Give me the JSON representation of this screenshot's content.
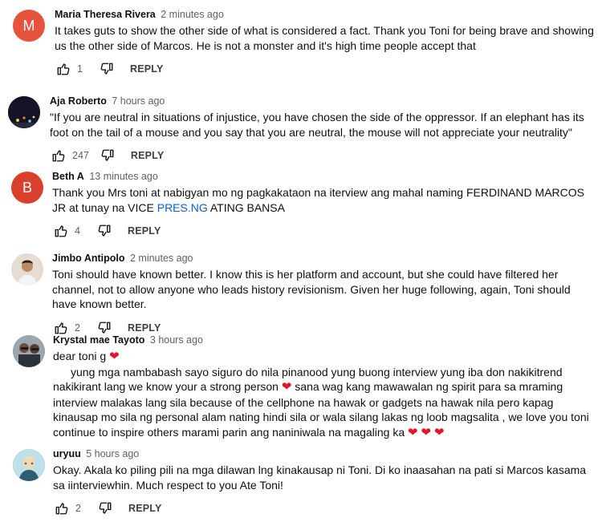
{
  "comments": [
    {
      "author": "Maria Theresa Rivera",
      "time": "2 minutes ago",
      "avatar_letter": "M",
      "avatar_color": "#e5533d",
      "text": "It takes guts to show the other side of what is considered a fact.  Thank you Toni for being brave and showing us the other side of Marcos.  He is not a monster and it's high time people accept that",
      "likes": "1",
      "reply_label": "REPLY"
    },
    {
      "author": "Aja Roberto",
      "time": "7 hours ago",
      "avatar_letter": "",
      "avatar_color": "#1b1b2e",
      "text": "\"If you are neutral in situations of injustice, you have chosen the side of the oppressor. If an elephant has its foot on the tail of a mouse and you say that you are neutral, the mouse will not appreciate your neutrality\"",
      "likes": "247",
      "reply_label": "REPLY"
    },
    {
      "author": "Beth A",
      "time": "13 minutes ago",
      "avatar_letter": "B",
      "avatar_color": "#d93f2b",
      "text_pre": "Thank you Mrs toni at nabigyan mo ng pagkakataon na iterview ang mahal naming FERDINAND MARCOS JR at tunay na VICE ",
      "text_link": "PRES.NG",
      "text_post": " ATING BANSA",
      "likes": "4",
      "reply_label": "REPLY"
    },
    {
      "author": "Jimbo Antipolo",
      "time": "2 minutes ago",
      "avatar_letter": "",
      "avatar_color": "#d8c7b8",
      "text": "Toni should have known better. I know this is her platform and account, but she could have filtered her channel, not to allow anyone who leads history revisionism. Given her huge following, again, Toni should have known better.",
      "likes": "2",
      "reply_label": "REPLY"
    },
    {
      "author": "Krystal mae Tayoto",
      "time": "3 hours ago",
      "avatar_letter": "",
      "avatar_color": "#8a9aa6",
      "line1": "dear toni g",
      "line2_indent": "yung mga nambabash sayo siguro do nila pinanood yung buong interview yung iba don nakikitrend nakikirant lang we know your a strong person",
      "line2_cont": " sana wag kang mawawalan ng spirit para sa mraming interview malakas lang sila because of the cellphone na hawak or gadgets na hawak nila pero kapag kinausap mo sila ng personal alam nating hindi sila or wala silang lakas ng loob magsalita , we love you toni continue to inspire others marami parin ang naniniwala na magaling ka",
      "heart": "❤"
    },
    {
      "author": "uryuu",
      "time": "5 hours ago",
      "avatar_letter": "",
      "avatar_color": "#5a8a9c",
      "text": "Okay. Akala ko piling pili na mga dilawan lng kinakausap ni Toni. Di ko inaasahan na pati si Marcos kasama sa iinterviewhin. Much respect to you Ate Toni!",
      "likes": "2",
      "reply_label": "REPLY"
    }
  ],
  "icons": {
    "like": "thumbs-up-icon",
    "dislike": "thumbs-down-icon",
    "heart": "heart-icon"
  }
}
